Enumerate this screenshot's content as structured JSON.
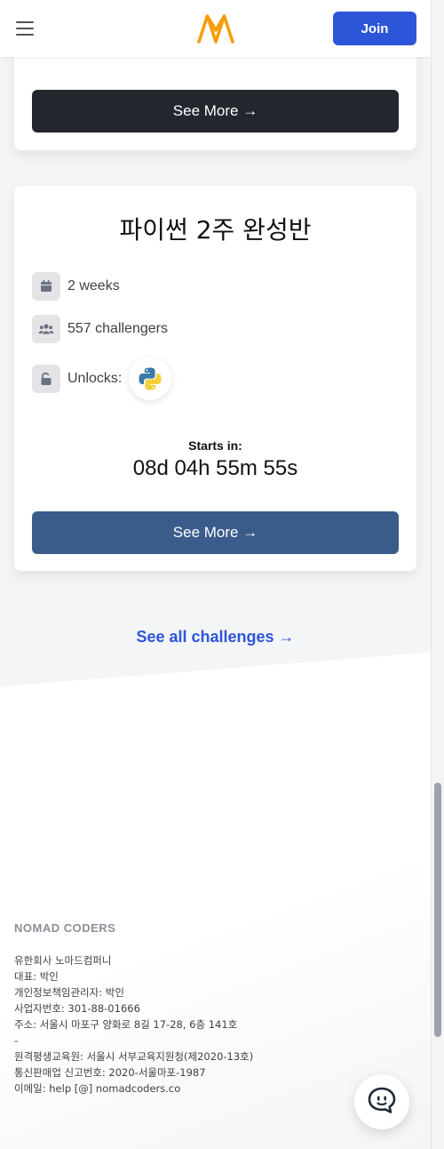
{
  "header": {
    "join_label": "Join",
    "brand_color": "#F59E0B",
    "join_color": "#2D55D8"
  },
  "top_card": {
    "button_label": "See More →"
  },
  "challenge": {
    "title": "파이썬 2주 완성반",
    "duration": "2 weeks",
    "challengers": "557 challengers",
    "unlocks_label": "Unlocks:",
    "unlock_icon": "python-logo",
    "starts_label": "Starts in:",
    "countdown": "08d 04h 55m 55s",
    "button_label": "See More →"
  },
  "see_all_label": "See all challenges →",
  "footer": {
    "brand": "NOMAD CODERS",
    "lines": [
      "유한회사 노마드컴퍼니",
      "대표: 박인",
      "개인정보책임관리자: 박인",
      "사업자번호: 301-88-01666",
      "주소: 서울시 마포구 양화로 8길 17-28, 6층 141호",
      "-",
      "원격평생교육원: 서울시 서부교육지원청(제2020-13호)",
      "통신판매업 신고번호: 2020-서울마포-1987",
      "이메일: help [@] nomadcoders.co"
    ]
  }
}
